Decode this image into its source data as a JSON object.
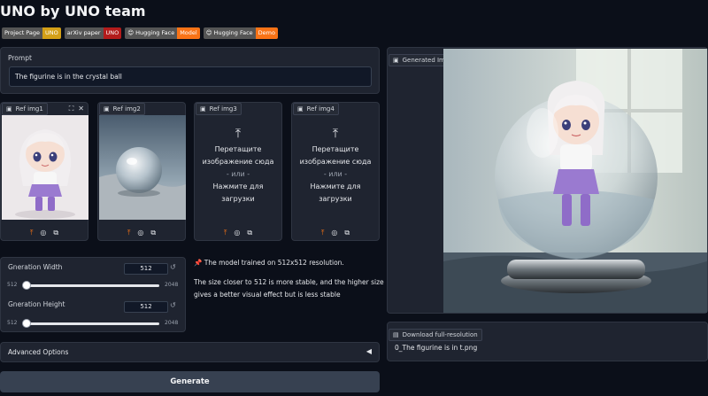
{
  "app": {
    "title": "UNO by UNO team"
  },
  "badges": [
    {
      "left": "Project Page",
      "right": "UNO",
      "color": "#d4a017"
    },
    {
      "left": "arXiv paper",
      "right": "UNO",
      "color": "#b31b1b"
    },
    {
      "left": "😊 Hugging Face",
      "right": "Model",
      "color": "#f97316"
    },
    {
      "left": "😊 Hugging Face",
      "right": "Demo",
      "color": "#f97316"
    }
  ],
  "prompt": {
    "label": "Prompt",
    "value": "The figurine is in the crystal ball"
  },
  "refs": [
    {
      "label": "Ref img1"
    },
    {
      "label": "Ref img2"
    },
    {
      "label": "Ref img3"
    },
    {
      "label": "Ref img4"
    }
  ],
  "dropzone": {
    "line1": "Перетащите",
    "line2": "изображение сюда",
    "or": "- или -",
    "line3": "Нажмите для",
    "line4": "загрузки"
  },
  "width_slider": {
    "label": "Gneration Width",
    "value": "512",
    "min": "512",
    "max": "2048",
    "level": 0.0
  },
  "height_slider": {
    "label": "Gneration Height",
    "value": "512",
    "min": "512",
    "max": "2048",
    "level": 0.0
  },
  "info": {
    "pin": "📌",
    "note1": "The model trained on 512x512 resolution.",
    "note2a": "The size closer to 512 is more stable, and the higher size",
    "note2b": "gives a better visual effect but is less stable"
  },
  "advanced": {
    "label": "Advanced Options",
    "caret": "◀"
  },
  "generate": {
    "label": "Generate"
  },
  "output": {
    "label": "Generated Image"
  },
  "download": {
    "label": "Download full-resolution",
    "filename": "0_The figurine is in t.png"
  },
  "colors": {
    "accent": "#f97316",
    "bg": "#0b0f19",
    "panel": "#1f2430"
  }
}
